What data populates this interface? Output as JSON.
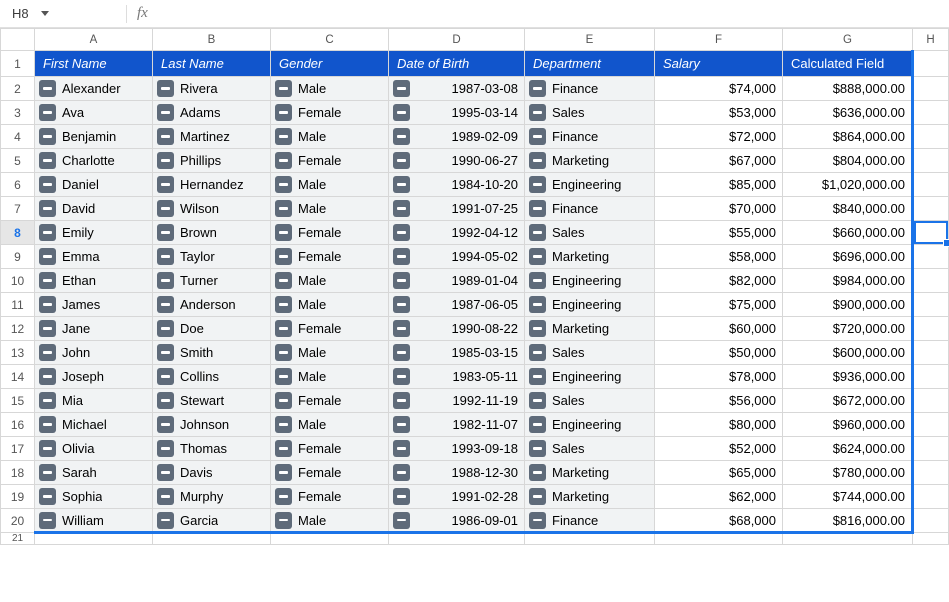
{
  "namebox": {
    "cell_ref": "H8"
  },
  "columns": [
    "A",
    "B",
    "C",
    "D",
    "E",
    "F",
    "G",
    "H"
  ],
  "row_numbers": [
    1,
    2,
    3,
    4,
    5,
    6,
    7,
    8,
    9,
    10,
    11,
    12,
    13,
    14,
    15,
    16,
    17,
    18,
    19,
    20,
    21
  ],
  "header_row": {
    "A": "First Name",
    "B": "Last Name",
    "C": "Gender",
    "D": "Date of Birth",
    "E": "Department",
    "F": "Salary",
    "G": "Calculated Field"
  },
  "rows": [
    {
      "first": "Alexander",
      "last": "Rivera",
      "gender": "Male",
      "dob": "1987-03-08",
      "dept": "Finance",
      "salary": "$74,000",
      "calc": "$888,000.00"
    },
    {
      "first": "Ava",
      "last": "Adams",
      "gender": "Female",
      "dob": "1995-03-14",
      "dept": "Sales",
      "salary": "$53,000",
      "calc": "$636,000.00"
    },
    {
      "first": "Benjamin",
      "last": "Martinez",
      "gender": "Male",
      "dob": "1989-02-09",
      "dept": "Finance",
      "salary": "$72,000",
      "calc": "$864,000.00"
    },
    {
      "first": "Charlotte",
      "last": "Phillips",
      "gender": "Female",
      "dob": "1990-06-27",
      "dept": "Marketing",
      "salary": "$67,000",
      "calc": "$804,000.00"
    },
    {
      "first": "Daniel",
      "last": "Hernandez",
      "gender": "Male",
      "dob": "1984-10-20",
      "dept": "Engineering",
      "salary": "$85,000",
      "calc": "$1,020,000.00"
    },
    {
      "first": "David",
      "last": "Wilson",
      "gender": "Male",
      "dob": "1991-07-25",
      "dept": "Finance",
      "salary": "$70,000",
      "calc": "$840,000.00"
    },
    {
      "first": "Emily",
      "last": "Brown",
      "gender": "Female",
      "dob": "1992-04-12",
      "dept": "Sales",
      "salary": "$55,000",
      "calc": "$660,000.00"
    },
    {
      "first": "Emma",
      "last": "Taylor",
      "gender": "Female",
      "dob": "1994-05-02",
      "dept": "Marketing",
      "salary": "$58,000",
      "calc": "$696,000.00"
    },
    {
      "first": "Ethan",
      "last": "Turner",
      "gender": "Male",
      "dob": "1989-01-04",
      "dept": "Engineering",
      "salary": "$82,000",
      "calc": "$984,000.00"
    },
    {
      "first": "James",
      "last": "Anderson",
      "gender": "Male",
      "dob": "1987-06-05",
      "dept": "Engineering",
      "salary": "$75,000",
      "calc": "$900,000.00"
    },
    {
      "first": "Jane",
      "last": "Doe",
      "gender": "Female",
      "dob": "1990-08-22",
      "dept": "Marketing",
      "salary": "$60,000",
      "calc": "$720,000.00"
    },
    {
      "first": "John",
      "last": "Smith",
      "gender": "Male",
      "dob": "1985-03-15",
      "dept": "Sales",
      "salary": "$50,000",
      "calc": "$600,000.00"
    },
    {
      "first": "Joseph",
      "last": "Collins",
      "gender": "Male",
      "dob": "1983-05-11",
      "dept": "Engineering",
      "salary": "$78,000",
      "calc": "$936,000.00"
    },
    {
      "first": "Mia",
      "last": "Stewart",
      "gender": "Female",
      "dob": "1992-11-19",
      "dept": "Sales",
      "salary": "$56,000",
      "calc": "$672,000.00"
    },
    {
      "first": "Michael",
      "last": "Johnson",
      "gender": "Male",
      "dob": "1982-11-07",
      "dept": "Engineering",
      "salary": "$80,000",
      "calc": "$960,000.00"
    },
    {
      "first": "Olivia",
      "last": "Thomas",
      "gender": "Female",
      "dob": "1993-09-18",
      "dept": "Sales",
      "salary": "$52,000",
      "calc": "$624,000.00"
    },
    {
      "first": "Sarah",
      "last": "Davis",
      "gender": "Female",
      "dob": "1988-12-30",
      "dept": "Marketing",
      "salary": "$65,000",
      "calc": "$780,000.00"
    },
    {
      "first": "Sophia",
      "last": "Murphy",
      "gender": "Female",
      "dob": "1991-02-28",
      "dept": "Marketing",
      "salary": "$62,000",
      "calc": "$744,000.00"
    },
    {
      "first": "William",
      "last": "Garcia",
      "gender": "Male",
      "dob": "1986-09-01",
      "dept": "Finance",
      "salary": "$68,000",
      "calc": "$816,000.00"
    }
  ],
  "active_row": 8
}
